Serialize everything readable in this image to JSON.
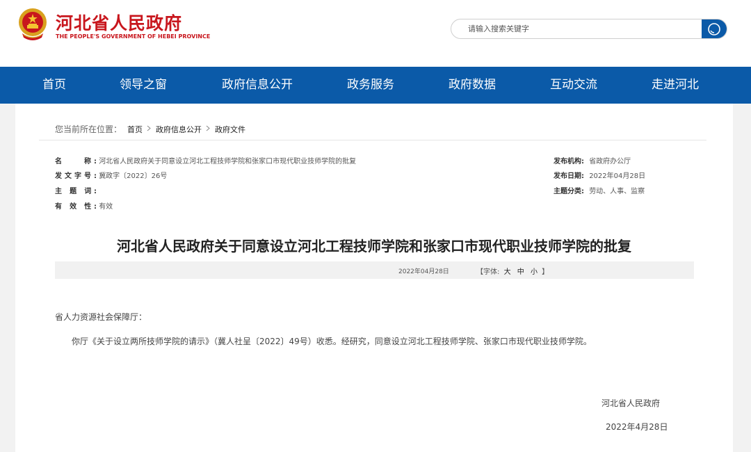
{
  "header": {
    "site_title": "河北省人民政府",
    "site_subtitle": "THE PEOPLE'S GOVERNMENT OF HEBEI PROVINCE",
    "search_placeholder": "请输入搜索关键字",
    "logo_icon": "national-emblem-icon",
    "search_icon": "search-icon",
    "brand_color": "#c8161d"
  },
  "nav": {
    "color": "#0b5aa8",
    "items": [
      "首页",
      "领导之窗",
      "政府信息公开",
      "政务服务",
      "政府数据",
      "互动交流",
      "走进河北"
    ]
  },
  "breadcrumb": {
    "prefix": "您当前所在位置：",
    "items": [
      "首页",
      "政府信息公开",
      "政府文件"
    ],
    "separator_icon": "chevron-right-icon"
  },
  "meta": {
    "name_label": "名　　称:",
    "name_value": "河北省人民政府关于同意设立河北工程技师学院和张家口市现代职业技师学院的批复",
    "doc_no_label": "发文字号:",
    "doc_no_value": "冀政字〔2022〕26号",
    "subject_label": "主 题 词:",
    "subject_value": "",
    "validity_label": "有 效 性:",
    "validity_value": "有效",
    "publisher_label": "发布机构:",
    "publisher_value": "省政府办公厅",
    "date_label": "发布日期:",
    "date_value": "2022年04月28日",
    "category_label": "主题分类:",
    "category_value": "劳动、人事、监察"
  },
  "article": {
    "title": "河北省人民政府关于同意设立河北工程技师学院和张家口市现代职业技师学院的批复",
    "date": "2022年04月28日",
    "font_prefix": "【字体:",
    "font_large": "大",
    "font_medium": "中",
    "font_small": "小",
    "font_suffix": "】",
    "recipient": "省人力资源社会保障厅：",
    "body": "你厅《关于设立两所技师学院的请示》（冀人社呈〔2022〕49号）收悉。经研究，同意设立河北工程技师学院、张家口市现代职业技师学院。",
    "signature_org": "河北省人民政府",
    "signature_date": "2022年4月28日"
  }
}
